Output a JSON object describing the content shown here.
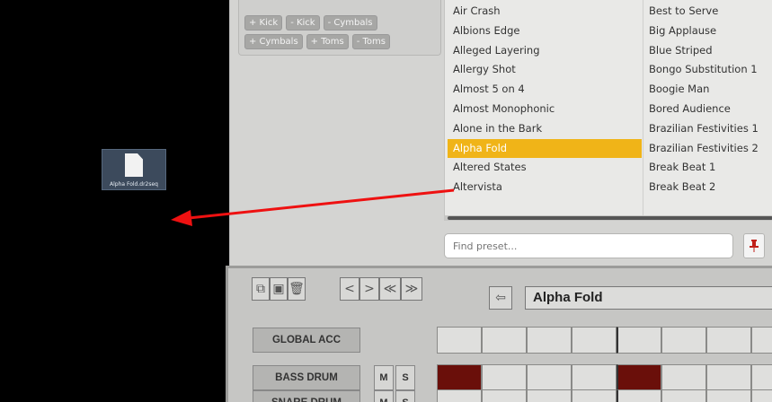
{
  "desktop": {
    "file_icon": {
      "icon": "document-icon",
      "filename": "Alpha Fold.dr2seq"
    }
  },
  "tags": {
    "row1": [
      "+ Kick",
      "- Kick",
      "- Cymbals"
    ],
    "row2": [
      "+ Cymbals",
      "+ Toms",
      "- Toms"
    ]
  },
  "presets": {
    "column1": [
      "Air Crash",
      "Albions Edge",
      "Alleged Layering",
      "Allergy Shot",
      "Almost 5 on 4",
      "Almost Monophonic",
      "Alone in the Bark",
      "Alpha Fold",
      "Altered States",
      "Altervista"
    ],
    "column2": [
      "Best to Serve",
      "Big Applause",
      "Blue Striped",
      "Bongo Substitution 1",
      "Boogie Man",
      "Bored Audience",
      "Brazilian Festivities 1",
      "Brazilian Festivities 2",
      "Break Beat 1",
      "Break Beat 2"
    ],
    "selected": "Alpha Fold",
    "selected_color": "#f0b418"
  },
  "search": {
    "placeholder": "Find preset...",
    "pin_icon": "pin-icon"
  },
  "sequencer": {
    "pattern_name": "Alpha Fold",
    "toolbar_icons": [
      "copy-icon",
      "paste-icon",
      "delete-icon",
      "prev-icon",
      "next-icon",
      "rewind-icon",
      "fast-forward-icon",
      "load-icon"
    ],
    "lanes": [
      {
        "label": "GLOBAL ACC",
        "has_ms": false,
        "steps": [
          0,
          0,
          0,
          0,
          0,
          0,
          0,
          0
        ]
      },
      {
        "label": "BASS DRUM",
        "has_ms": true,
        "mute": "M",
        "solo": "S",
        "steps": [
          1,
          0,
          0,
          0,
          1,
          0,
          0,
          0
        ]
      },
      {
        "label": "SNARE DRUM",
        "has_ms": true,
        "mute": "M",
        "solo": "S",
        "steps": [
          0,
          0,
          0,
          0,
          0,
          0,
          0,
          0
        ]
      }
    ],
    "step_on_color": "#6a0f0a"
  },
  "arrow_color": "#ee1111"
}
